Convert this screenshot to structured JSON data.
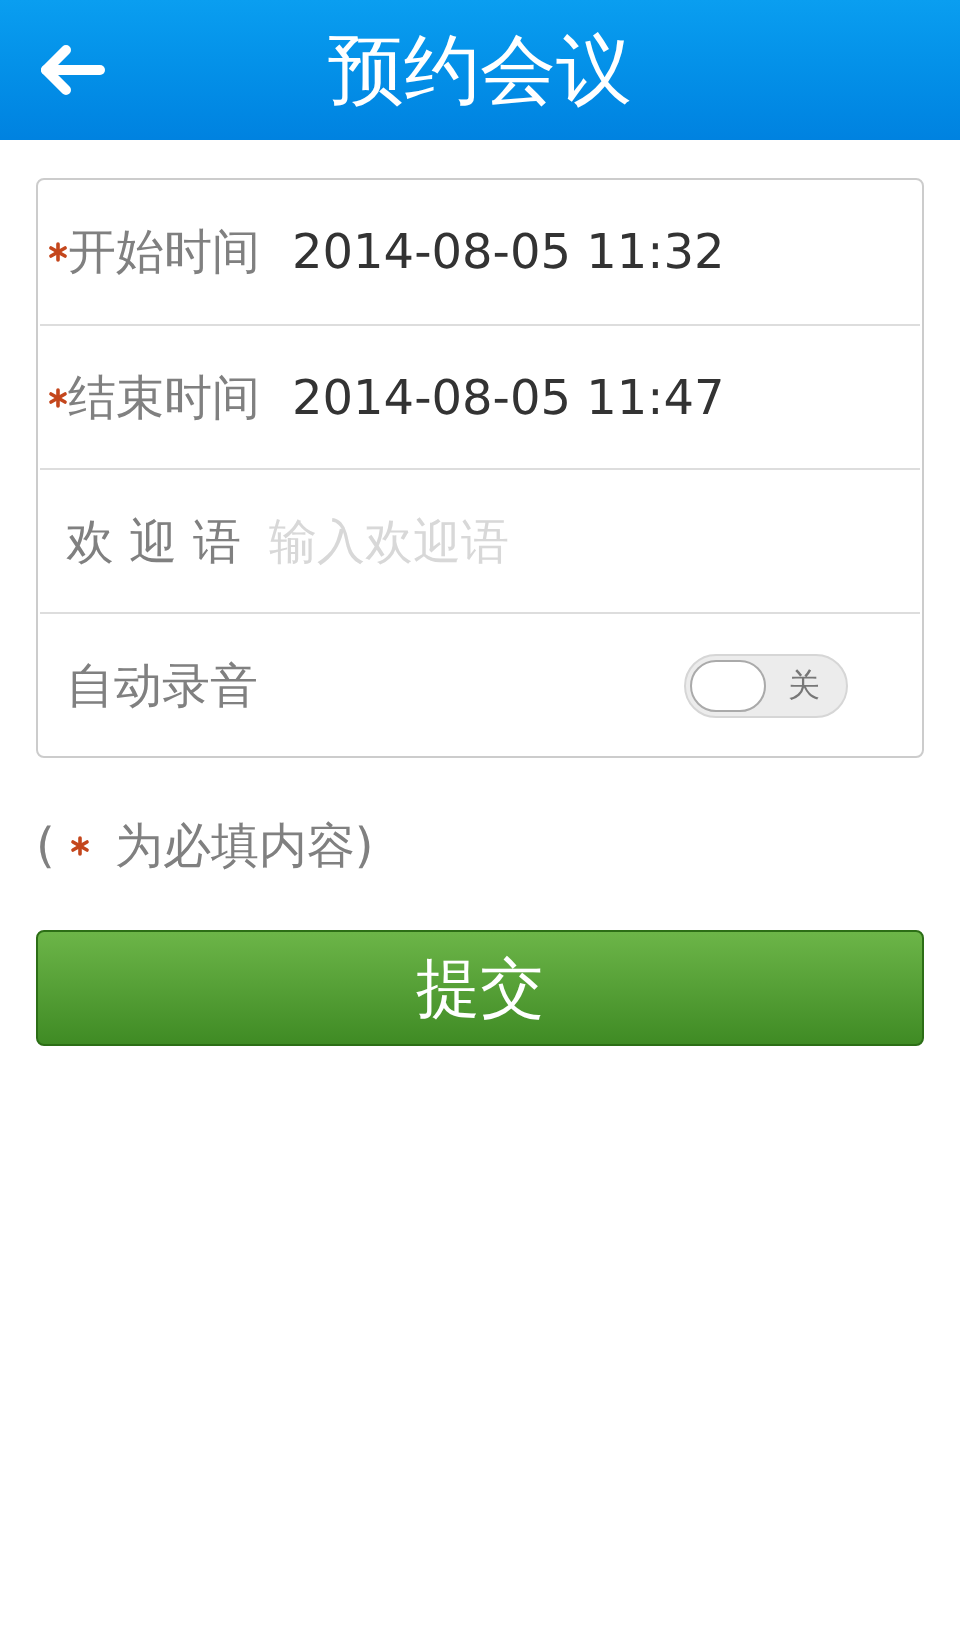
{
  "header": {
    "title": "预约会议"
  },
  "form": [
    {
      "kind": "value",
      "label": "开始时间",
      "required": true,
      "value": "2014-08-05 11:32"
    },
    {
      "kind": "value",
      "label": "结束时间",
      "required": true,
      "value": "2014-08-05 11:47"
    },
    {
      "kind": "input",
      "label": "欢 迎 语",
      "required": false,
      "placeholder": "输入欢迎语"
    },
    {
      "kind": "toggle",
      "label": "自动录音",
      "required": false,
      "on": false,
      "state_label": "关"
    }
  ],
  "note": {
    "open": "(",
    "text": "为必填内容)"
  },
  "submit": "提交"
}
